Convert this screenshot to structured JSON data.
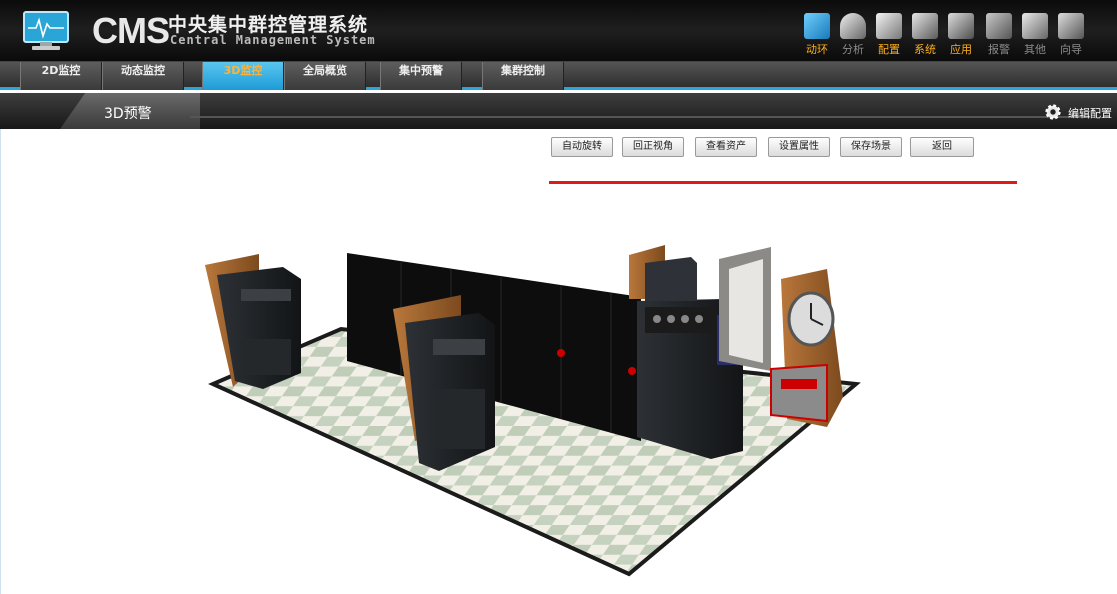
{
  "app": {
    "logo_cms": "CMS",
    "logo_cn": "中央集中群控管理系统",
    "logo_en": "Central Management System"
  },
  "top_nav": [
    {
      "label": "动环",
      "color": "orange",
      "icon": "monitor-icon"
    },
    {
      "label": "分析",
      "color": "gray",
      "icon": "analysis-icon"
    },
    {
      "label": "配置",
      "color": "orange",
      "icon": "config-icon"
    },
    {
      "label": "系统",
      "color": "orange",
      "icon": "system-icon"
    },
    {
      "label": "应用",
      "color": "orange",
      "icon": "app-icon"
    },
    {
      "label": "报警",
      "color": "gray",
      "icon": "alarm-icon"
    },
    {
      "label": "其他",
      "color": "gray",
      "icon": "other-icon"
    },
    {
      "label": "向导",
      "color": "gray",
      "icon": "wizard-icon"
    }
  ],
  "tabs": [
    {
      "label": "2D监控",
      "active": false
    },
    {
      "label": "动态监控",
      "active": false
    },
    {
      "label": "3D监控",
      "active": true
    },
    {
      "label": "全局概览",
      "active": false
    },
    {
      "label": "集中预警",
      "active": false
    },
    {
      "label": "集群控制",
      "active": false
    }
  ],
  "subbar": {
    "title": "3D预警",
    "settings_label": "编辑配置"
  },
  "toolbar": {
    "buttons": [
      "自动旋转",
      "回正视角",
      "查看资产",
      "设置属性",
      "保存场景",
      "返回"
    ]
  },
  "colors": {
    "accent_blue": "#2aa5d8",
    "tab_active_text": "#ffb238",
    "nav_orange": "#ffae1a",
    "red_line": "#e01a1a"
  }
}
